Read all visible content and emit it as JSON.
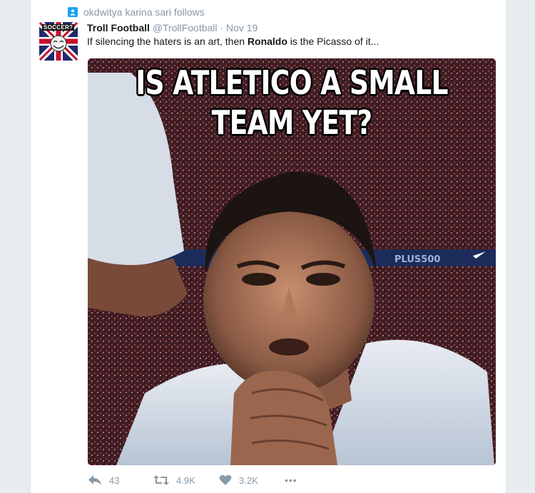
{
  "context": {
    "text": "okdwitya karina sari follows"
  },
  "tweet": {
    "author_name": "Troll Football",
    "author_handle": "@TrollFootball",
    "separator": "·",
    "timestamp": "Nov 19",
    "text_before": "If silencing the haters is an art, then ",
    "text_bold": "Ronaldo",
    "text_after": " is the Picasso of it..."
  },
  "avatar": {
    "label": "SOCCER?"
  },
  "media": {
    "caption_line1": "IS ATLETICO A SMALL",
    "caption_line2": "TEAM YET?",
    "board_text": "PLUS500"
  },
  "actions": {
    "reply_count": "43",
    "retweet_count": "4.9K",
    "like_count": "3.2K",
    "more_label": "•••"
  },
  "colors": {
    "accent": "#1da1f2",
    "muted_text": "#8899a6",
    "primary_text": "#14171a"
  }
}
